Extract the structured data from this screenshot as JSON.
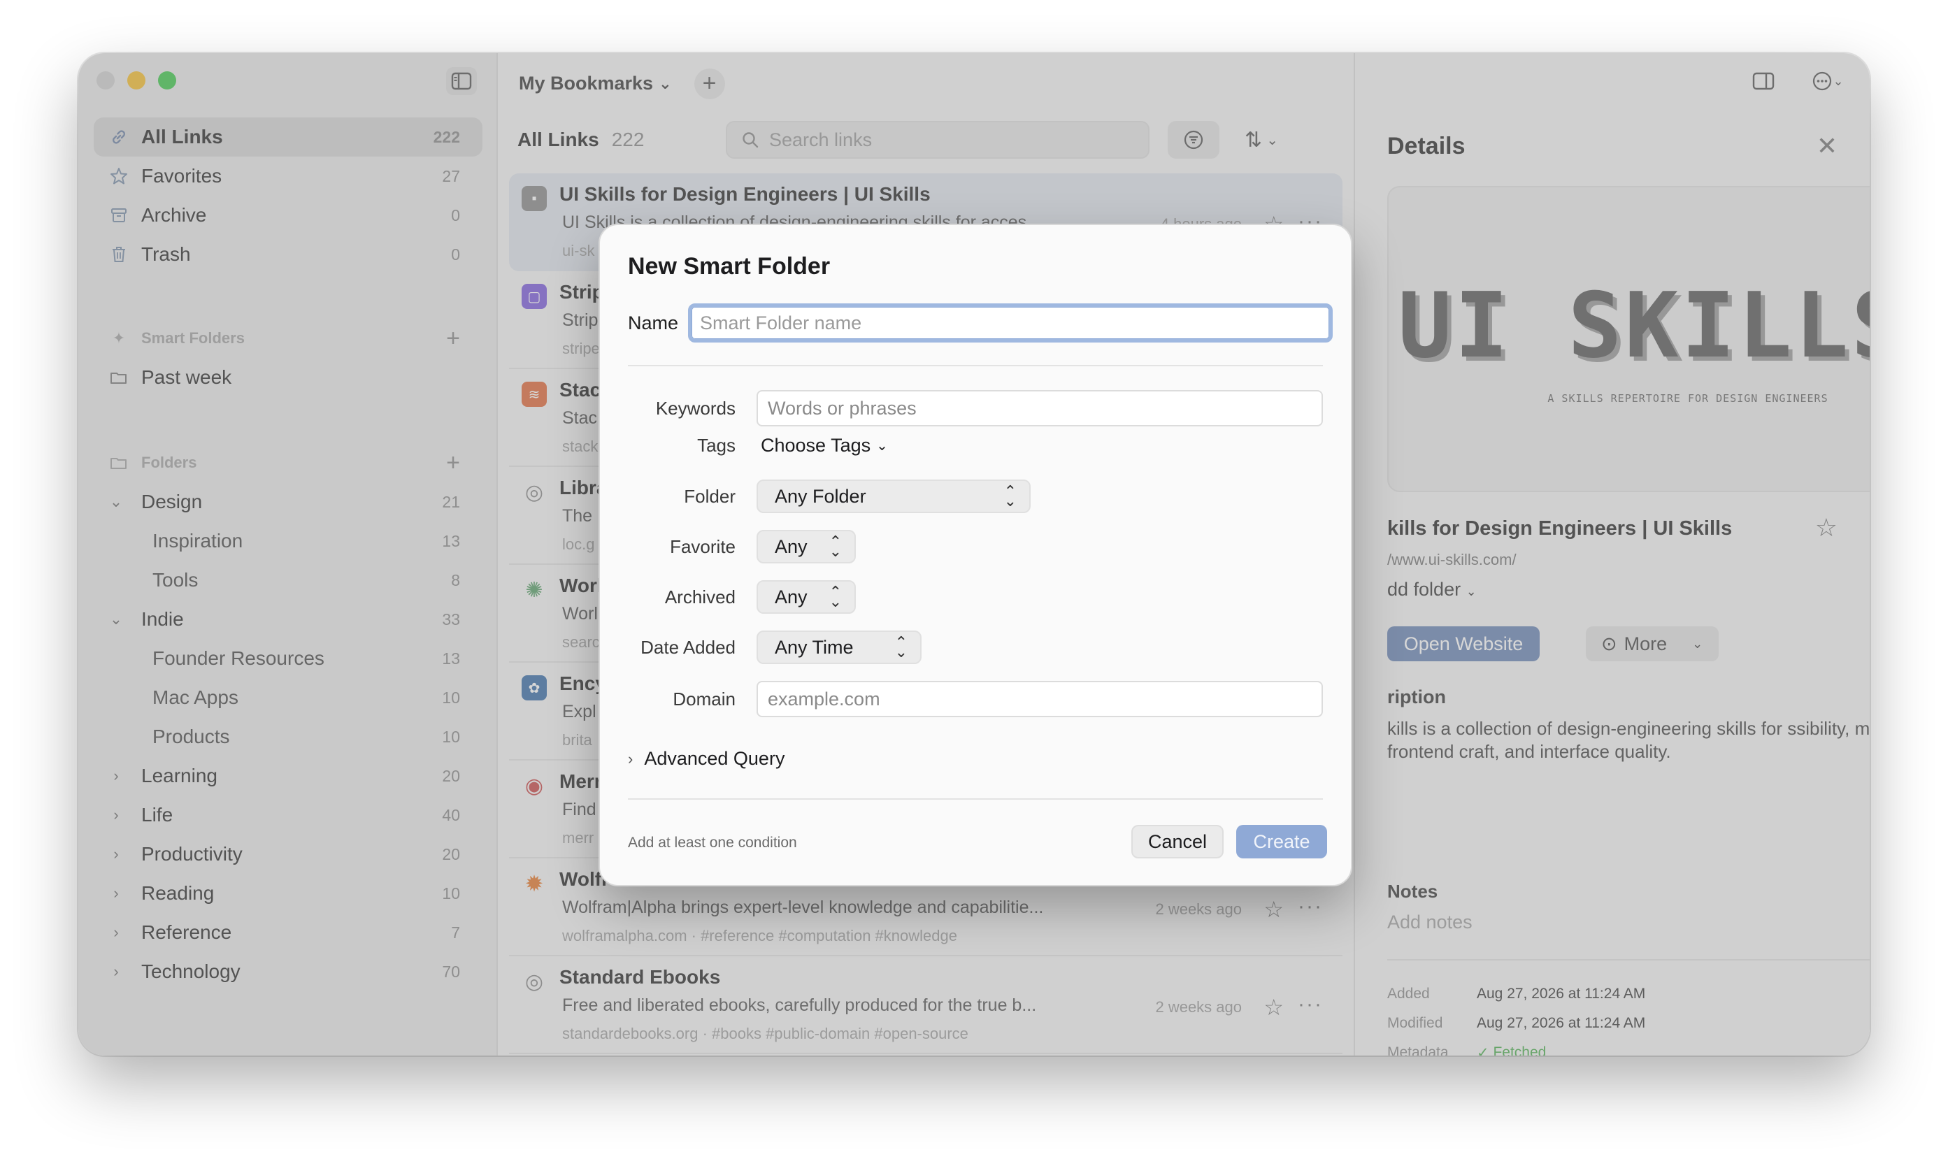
{
  "sidebar": {
    "main": [
      {
        "label": "All Links",
        "count": "222",
        "icon": "link-icon"
      },
      {
        "label": "Favorites",
        "count": "27",
        "icon": "star-icon"
      },
      {
        "label": "Archive",
        "count": "0",
        "icon": "archive-icon"
      },
      {
        "label": "Trash",
        "count": "0",
        "icon": "trash-icon"
      }
    ],
    "smart_folders_header": "Smart Folders",
    "smart_folders": [
      {
        "label": "Past week"
      }
    ],
    "folders_header": "Folders",
    "folders": [
      {
        "label": "Design",
        "count": "21",
        "expanded": true
      },
      {
        "label": "Inspiration",
        "count": "13",
        "child": true
      },
      {
        "label": "Tools",
        "count": "8",
        "child": true
      },
      {
        "label": "Indie",
        "count": "33",
        "expanded": true
      },
      {
        "label": "Founder Resources",
        "count": "13",
        "child": true
      },
      {
        "label": "Mac Apps",
        "count": "10",
        "child": true
      },
      {
        "label": "Products",
        "count": "10",
        "child": true
      },
      {
        "label": "Learning",
        "count": "20"
      },
      {
        "label": "Life",
        "count": "40"
      },
      {
        "label": "Productivity",
        "count": "20"
      },
      {
        "label": "Reading",
        "count": "10"
      },
      {
        "label": "Reference",
        "count": "7"
      },
      {
        "label": "Technology",
        "count": "70"
      }
    ]
  },
  "toolbar": {
    "library": "My Bookmarks"
  },
  "list": {
    "title": "All Links",
    "count": "222",
    "search_placeholder": "Search links",
    "rows": [
      {
        "title": "UI Skills for Design Engineers | UI Skills",
        "desc": "UI Skills is a collection of design-engineering skills for acces",
        "meta": "ui-sk",
        "time": "4 hours ago",
        "color": "#8a8a8a"
      },
      {
        "title": "Strip",
        "desc": "Strip",
        "meta": "stripe",
        "time": "",
        "color": "#7c5cdb"
      },
      {
        "title": "Stac",
        "desc": "Stac",
        "meta": "stack",
        "time": "",
        "color": "#e06a3a"
      },
      {
        "title": "Libra",
        "desc": "The",
        "meta": "loc.g",
        "time": "",
        "color": "#9a9a9a"
      },
      {
        "title": "Worl",
        "desc": "Worl",
        "meta": "searc",
        "time": "",
        "color": "#5aa06a"
      },
      {
        "title": "Ency",
        "desc": "Expl",
        "meta": "brita",
        "time": "",
        "color": "#3b6fa8"
      },
      {
        "title": "Merr",
        "desc": "Find",
        "meta": "merr",
        "time": "",
        "color": "#c94a4a"
      },
      {
        "title": "Wolfr",
        "desc": "Wolfram|Alpha brings expert-level knowledge and capabilitie...",
        "meta": "wolframalpha.com  ·  #reference    #computation    #knowledge",
        "time": "2 weeks ago",
        "color": "#e57a2e"
      },
      {
        "title": "Standard Ebooks",
        "desc": "Free and liberated ebooks, carefully produced for the true b...",
        "meta": "standardebooks.org  ·  #books    #public-domain    #open-source",
        "time": "2 weeks ago",
        "color": "#9a9a9a"
      }
    ]
  },
  "details": {
    "title": "Details",
    "preview_big": "UI SKILLS",
    "preview_small": "A SKILLS REPERTOIRE FOR DESIGN ENGINEERS",
    "name": "kills for Design Engineers | UI Skills",
    "url": "/www.ui-skills.com/",
    "folder": "dd folder",
    "open_label": "Open Website",
    "more_label": "More",
    "desc_header": "ription",
    "desc": "kills is a collection of design-engineering skills for ssibility, motion, frontend craft, and interface quality.",
    "notes_header": "Notes",
    "notes_placeholder": "Add notes",
    "info": [
      {
        "k": "Added",
        "v": "Aug 27, 2026 at 11:24 AM"
      },
      {
        "k": "Modified",
        "v": "Aug 27, 2026 at 11:24 AM"
      },
      {
        "k": "Metadata",
        "v": "Fetched"
      }
    ]
  },
  "dialog": {
    "title": "New Smart Folder",
    "name_label": "Name",
    "name_placeholder": "Smart Folder name",
    "keywords_label": "Keywords",
    "keywords_placeholder": "Words or phrases",
    "tags_label": "Tags",
    "tags_value": "Choose Tags",
    "folder_label": "Folder",
    "folder_value": "Any Folder",
    "favorite_label": "Favorite",
    "favorite_value": "Any",
    "archived_label": "Archived",
    "archived_value": "Any",
    "date_label": "Date Added",
    "date_value": "Any Time",
    "domain_label": "Domain",
    "domain_placeholder": "example.com",
    "advanced_label": "Advanced Query",
    "footer_note": "Add at least one condition",
    "cancel_label": "Cancel",
    "create_label": "Create"
  }
}
